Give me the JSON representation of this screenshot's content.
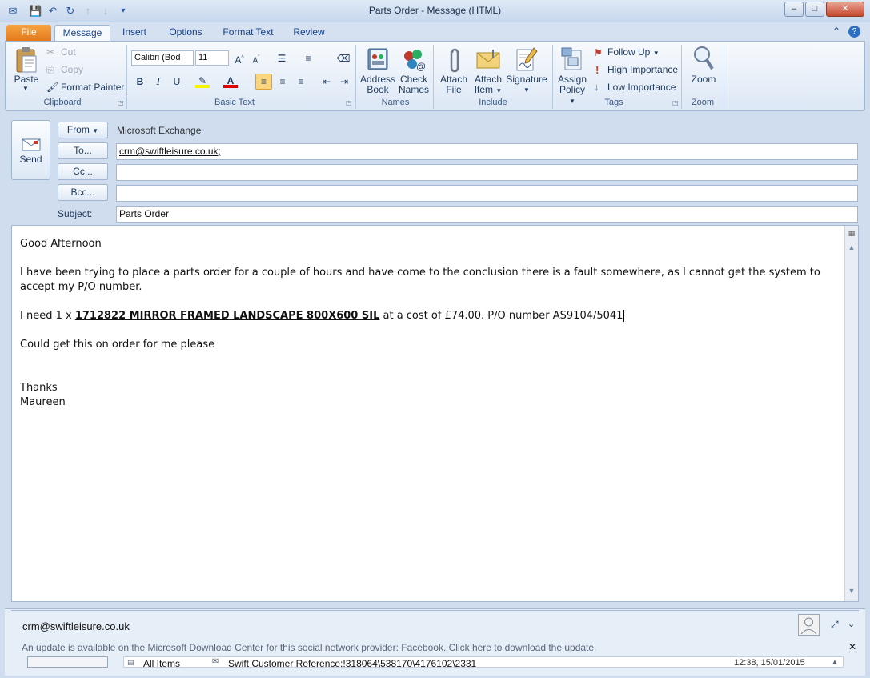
{
  "window": {
    "title": "Parts Order  -  Message (HTML)"
  },
  "tabs": [
    "File",
    "Message",
    "Insert",
    "Options",
    "Format Text",
    "Review"
  ],
  "clipboard": {
    "paste": "Paste",
    "cut": "Cut",
    "copy": "Copy",
    "format_painter": "Format Painter",
    "group": "Clipboard"
  },
  "basic_text": {
    "font": "Calibri (Bod",
    "size": "11",
    "group": "Basic Text"
  },
  "names": {
    "address_book_1": "Address",
    "address_book_2": "Book",
    "check_names_1": "Check",
    "check_names_2": "Names",
    "group": "Names"
  },
  "include": {
    "attach_file_1": "Attach",
    "attach_file_2": "File",
    "attach_item_1": "Attach",
    "attach_item_2": "Item",
    "signature": "Signature",
    "group": "Include"
  },
  "tags": {
    "assign_policy_1": "Assign",
    "assign_policy_2": "Policy",
    "follow_up": "Follow Up",
    "high": "High Importance",
    "low": "Low Importance",
    "group": "Tags"
  },
  "zoom": {
    "label": "Zoom",
    "group": "Zoom"
  },
  "header": {
    "send": "Send",
    "from_btn": "From",
    "from_value": "Microsoft Exchange",
    "to_btn": "To...",
    "to_value": "crm@swiftleisure.co.uk;",
    "cc_btn": "Cc...",
    "bcc_btn": "Bcc...",
    "subject_label": "Subject:",
    "subject_value": "Parts Order"
  },
  "body": {
    "greeting": "Good Afternoon",
    "para1": "I have been trying to place a parts order for a couple of hours and have come to the conclusion there is a fault somewhere, as I cannot get the system to accept my P/O number.",
    "line2_prefix": "I need 1 x ",
    "line2_part": "1712822 MIRROR FRAMED LANDSCAPE 800X600 SIL",
    "line2_suffix": " at a cost of £74.00.  P/O number AS9104/5041",
    "line3": "Could get this on order for me please",
    "thanks": "Thanks",
    "name": "Maureen"
  },
  "people_pane": {
    "contact": "crm@swiftleisure.co.uk",
    "update_notice": "An update is available on the Microsoft Download Center for this social network provider: Facebook. Click here to download the update.",
    "all_items": "All Items",
    "item_subject": "Swift Customer Reference:!318064\\538170\\4176102\\2331",
    "item_time": "12:38, 15/01/2015"
  }
}
